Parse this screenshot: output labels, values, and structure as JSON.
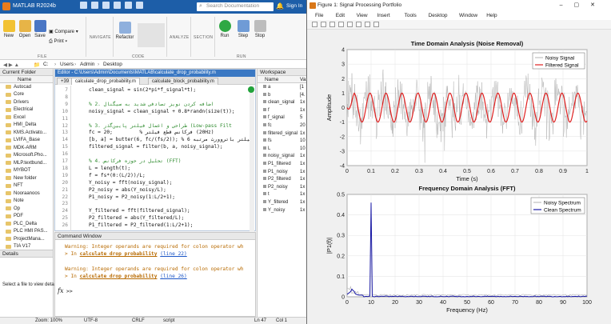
{
  "matlab": {
    "title": "MATLAB R2024b",
    "search_placeholder": "Search Documentation",
    "sign_in": "Sign In",
    "ribbon": {
      "new": "New",
      "open": "Open",
      "save": "Save",
      "compare": "Compare",
      "print": "Print",
      "navigate": "NAVIGATE",
      "refactor": "Refactor",
      "analyze": "ANALYZE",
      "section": "SECTION",
      "run": "Run",
      "step": "Step",
      "stop": "Stop",
      "file_label": "FILE",
      "code_label": "CODE",
      "run_label": "RUN"
    },
    "address": [
      "C:",
      "Users",
      "Admin",
      "Desktop"
    ],
    "current_folder": {
      "title": "Current Folder",
      "col": "Name",
      "items": [
        "Autocad",
        "Core",
        "Drivers",
        "Electrical",
        "Excel",
        "HMI_Delta",
        "KMS.Activato...",
        "LVIFA_Base",
        "MDK-ARM",
        "Microsoft.Pho...",
        "MLP.textbund...",
        "MYBOT",
        "New folder",
        "NFT",
        "Nooraanoos",
        "Note",
        "Op",
        "PDF",
        "PLC_Delta",
        "PLC HMI PAS...",
        "ProjectMana...",
        "TIA V17",
        "TRADE IUOR..."
      ]
    },
    "details": {
      "title": "Details",
      "message": "Select a file to view details"
    },
    "editor": {
      "title": "Editor - C:\\Users\\Admin\\Documents\\MATLAB\\calculate_drop_probability.m",
      "tab_count": "+39",
      "tabs": [
        "calculate_drop_probability.m",
        "calculate_block_probability.m"
      ],
      "lines": [
        {
          "n": "7",
          "text": "clean_signal = sin(2*pi*f_signal*t);",
          "comment": false
        },
        {
          "n": "8",
          "text": "",
          "comment": false
        },
        {
          "n": "9",
          "text": "% 2. اضافه کردن نویز تصادفی شدید به سیگنال",
          "comment": true
        },
        {
          "n": "10",
          "text": "noisy_signal = clean_signal + 0.8*randn(size(t));",
          "comment": false
        },
        {
          "n": "11",
          "text": "",
          "comment": false
        },
        {
          "n": "12",
          "text": "% 3. طراحی و اعمال فیلتر پایین‌گذر (Low-pass Filt",
          "comment": true
        },
        {
          "n": "13",
          "text": "fc = 20;         % فرکانس قطع فیلتر (20Hz)",
          "comment": false
        },
        {
          "n": "14",
          "text": "[b, a] = butter(6, fc/(fs/2)); % فیلتر باتروورث مرتبه 6",
          "comment": false
        },
        {
          "n": "15",
          "text": "filtered_signal = filter(b, a, noisy_signal);",
          "comment": false
        },
        {
          "n": "16",
          "text": "",
          "comment": false
        },
        {
          "n": "17",
          "text": "% 4. تحلیل در حوزه فرکانس (FFT)",
          "comment": true
        },
        {
          "n": "18",
          "text": "L = length(t);",
          "comment": false
        },
        {
          "n": "19",
          "text": "f = fs*(0:(L/2))/L;",
          "comment": false
        },
        {
          "n": "20",
          "text": "Y_noisy = fft(noisy_signal);",
          "comment": false
        },
        {
          "n": "21",
          "text": "P2_noisy = abs(Y_noisy/L);",
          "comment": false
        },
        {
          "n": "22",
          "text": "P1_noisy = P2_noisy(1:L/2+1);",
          "comment": false
        },
        {
          "n": "23",
          "text": "",
          "comment": false
        },
        {
          "n": "24",
          "text": "Y_filtered = fft(filtered_signal);",
          "comment": false
        },
        {
          "n": "25",
          "text": "P2_filtered = abs(Y_filtered/L);",
          "comment": false
        },
        {
          "n": "26",
          "text": "P1_filtered = P2_filtered(1:L/2+1);",
          "comment": false
        }
      ]
    },
    "command_window": {
      "title": "Command Window",
      "warn1": "Warning: Integer operands are required for colon operator wh",
      "in1": "> In ",
      "fn1": "calculate_drop_probability",
      "line1": "(line 22)",
      "warn2": "Warning: Integer operands are required for colon operator wh",
      "in2": "> In ",
      "fn2": "calculate_drop_probability",
      "line2": "(line 26)",
      "prompt": ">>"
    },
    "workspace": {
      "title": "Workspace",
      "col_name": "Name",
      "col_val": "Va",
      "vars": [
        {
          "name": "a",
          "val": "[1"
        },
        {
          "name": "b",
          "val": "[4."
        },
        {
          "name": "clean_signal",
          "val": "1x"
        },
        {
          "name": "f",
          "val": "1x"
        },
        {
          "name": "f_signal",
          "val": "5"
        },
        {
          "name": "fc",
          "val": "20"
        },
        {
          "name": "filtered_signal",
          "val": "1x"
        },
        {
          "name": "fs",
          "val": "10"
        },
        {
          "name": "L",
          "val": "10"
        },
        {
          "name": "noisy_signal",
          "val": "1x"
        },
        {
          "name": "P1_filtered",
          "val": "1x"
        },
        {
          "name": "P1_noisy",
          "val": "1x"
        },
        {
          "name": "P2_filtered",
          "val": "1x"
        },
        {
          "name": "P2_noisy",
          "val": "1x"
        },
        {
          "name": "t",
          "val": "1x"
        },
        {
          "name": "Y_filtered",
          "val": "1x"
        },
        {
          "name": "Y_noisy",
          "val": "1x"
        }
      ]
    },
    "status": {
      "zoom": "Zoom: 100%",
      "encoding": "UTF-8",
      "eol": "CRLF",
      "type": "script",
      "ln": "Ln 47",
      "col": "Col 1"
    }
  },
  "figure": {
    "title": "Figure 1: Signal Processing Portfolio",
    "menu": [
      "File",
      "Edit",
      "View",
      "Insert",
      "Tools",
      "Desktop",
      "Window",
      "Help"
    ]
  },
  "chart_data": [
    {
      "type": "line",
      "title": "Time Domain Analysis (Noise Removal)",
      "xlabel": "Time (s)",
      "ylabel": "Amplitude",
      "xlim": [
        0,
        1
      ],
      "ylim": [
        -4,
        4
      ],
      "xticks": [
        "0",
        "0.1",
        "0.2",
        "0.3",
        "0.4",
        "0.5",
        "0.6",
        "0.7",
        "0.8",
        "0.9",
        "1"
      ],
      "yticks": [
        "4",
        "3",
        "2",
        "1",
        "0",
        "-1",
        "-2",
        "-3",
        "-4"
      ],
      "legend_position": "top-right",
      "grid": true,
      "series": [
        {
          "name": "Noisy Signal",
          "color": "#b3b3b3",
          "noise_std": 0.8,
          "frequency_hz": 15
        },
        {
          "name": "Filtered Signal",
          "color": "#e02020",
          "amplitude": 1.0,
          "frequency_hz": 15
        }
      ]
    },
    {
      "type": "line",
      "title": "Frequency Domain Analysis (FFT)",
      "xlabel": "Frequency (Hz)",
      "ylabel": "|P1(f)|",
      "xlim": [
        0,
        100
      ],
      "ylim": [
        0,
        0.5
      ],
      "xticks": [
        "0",
        "10",
        "20",
        "30",
        "40",
        "50",
        "60",
        "70",
        "80",
        "90",
        "100"
      ],
      "yticks": [
        "0.5",
        "0.4",
        "0.3",
        "0.2",
        "0.1",
        "0"
      ],
      "legend_position": "top-right",
      "grid": true,
      "series": [
        {
          "name": "Noisy Spectrum",
          "color": "#b3b3b3",
          "peak": {
            "x": 10,
            "y": 0.45
          }
        },
        {
          "name": "Clean Spectrum",
          "color": "#1a1aa6",
          "peak": {
            "x": 10,
            "y": 0.46
          }
        }
      ]
    }
  ]
}
